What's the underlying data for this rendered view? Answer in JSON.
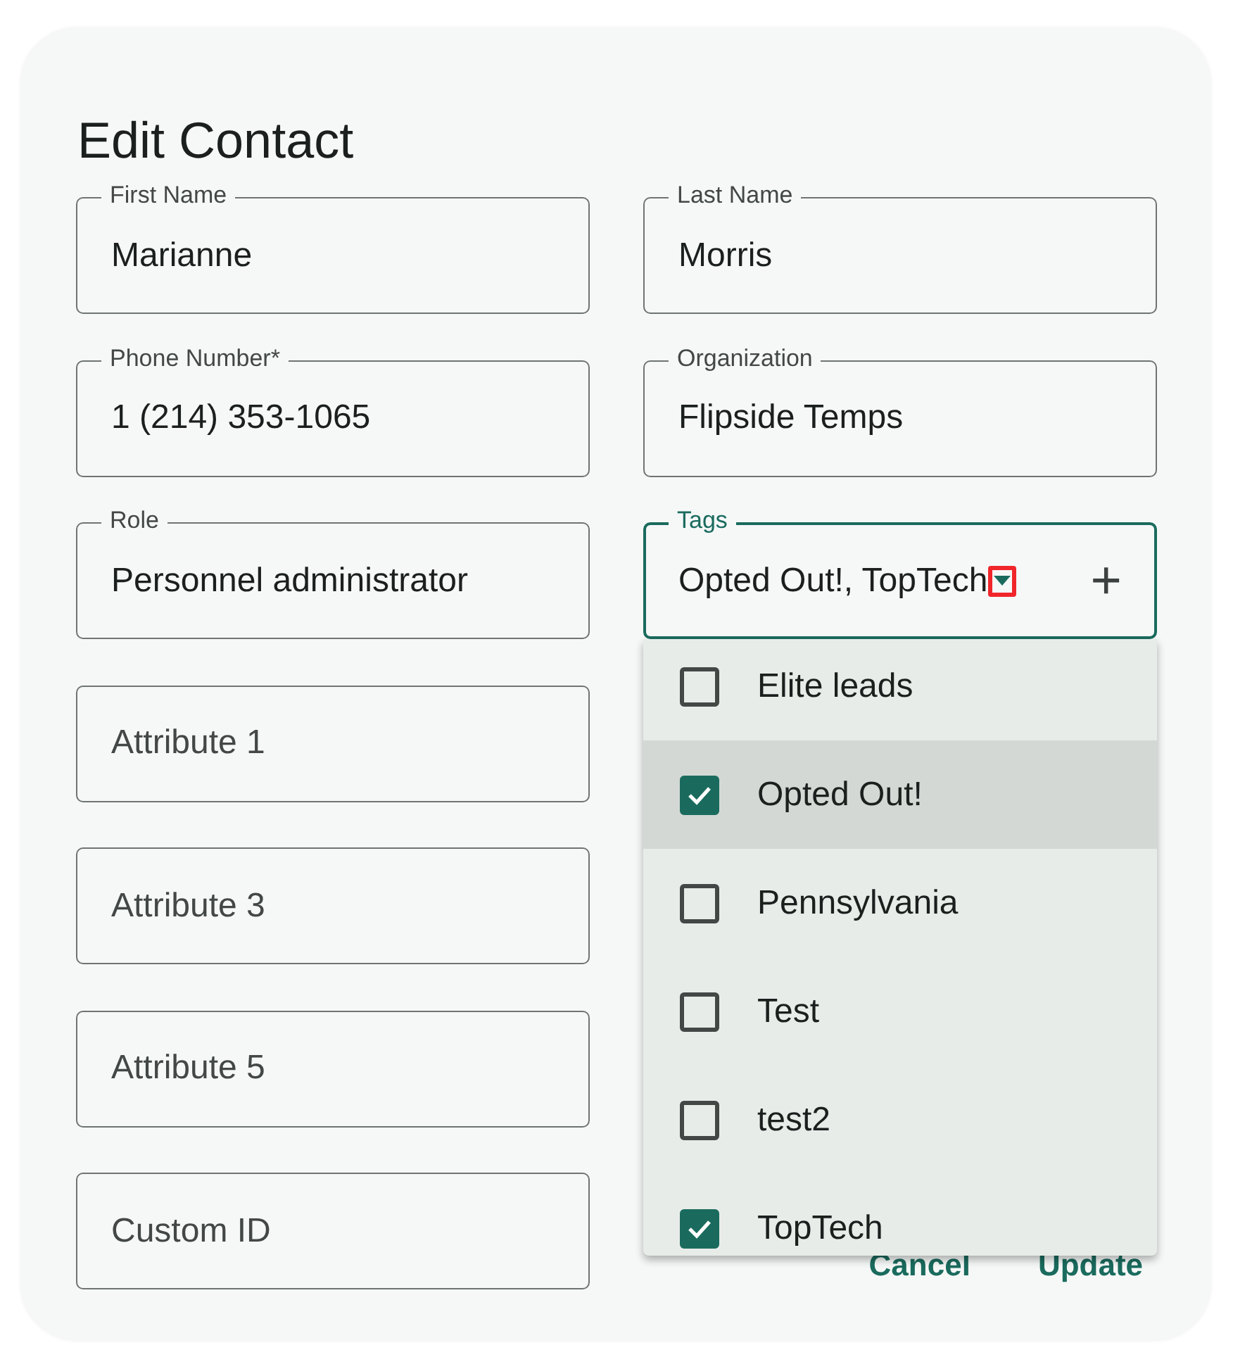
{
  "dialog": {
    "title": "Edit Contact"
  },
  "fields": [
    {
      "kind": "text",
      "label": "First Name",
      "value": "Marianne"
    },
    {
      "kind": "text",
      "label": "Last Name",
      "value": "Morris"
    },
    {
      "kind": "text",
      "label": "Phone Number*",
      "value": "1 (214) 353-1065"
    },
    {
      "kind": "text",
      "label": "Organization",
      "value": "Flipside Temps"
    },
    {
      "kind": "text",
      "label": "Role",
      "value": "Personnel administrator"
    },
    {
      "kind": "select",
      "label": "Tags",
      "value": "Opted Out!, TopTech",
      "focused": true,
      "expanded": true,
      "highlighted": true,
      "add": "+"
    },
    {
      "kind": "text",
      "placeholder": "Attribute 1"
    },
    {
      "kind": "text",
      "placeholder": "Attribute 3"
    },
    {
      "kind": "text",
      "placeholder": "Attribute 5"
    },
    {
      "kind": "text",
      "placeholder": "Custom ID"
    }
  ],
  "tag_options": [
    {
      "label": "Elite leads",
      "checked": false,
      "selected": false
    },
    {
      "label": "Opted Out!",
      "checked": true,
      "selected": true
    },
    {
      "label": "Pennsylvania",
      "checked": false,
      "selected": false
    },
    {
      "label": "Test",
      "checked": false,
      "selected": false
    },
    {
      "label": "test2",
      "checked": false,
      "selected": false
    },
    {
      "label": "TopTech",
      "checked": true,
      "selected": false
    }
  ],
  "buttons": [
    "Cancel",
    "Update"
  ]
}
